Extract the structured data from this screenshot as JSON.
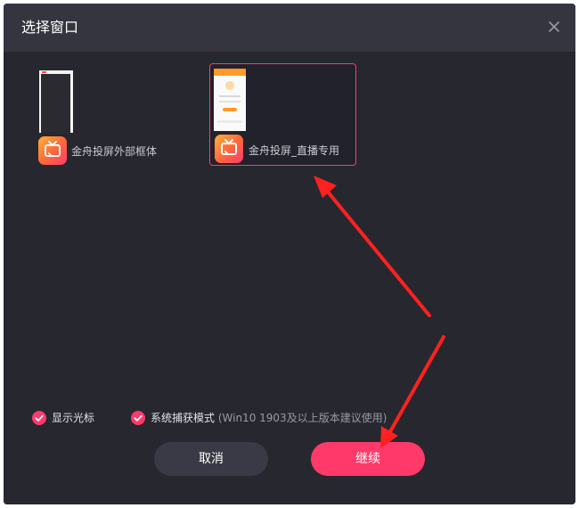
{
  "dialog": {
    "title": "选择窗口",
    "close_icon": "close-icon"
  },
  "windows": [
    {
      "label": "金舟投屏外部框体",
      "selected": false,
      "icon": "app-cast-icon"
    },
    {
      "label": "金舟投屏_直播专用",
      "selected": true,
      "icon": "app-cast-icon"
    }
  ],
  "options": {
    "show_cursor": {
      "label": "显示光标",
      "checked": true
    },
    "system_capture": {
      "label": "系统捕获模式",
      "hint": "(Win10 1903及以上版本建议使用)",
      "checked": true
    }
  },
  "buttons": {
    "cancel_label": "取消",
    "continue_label": "继续"
  },
  "colors": {
    "accent": "#ff3a6a",
    "background": "#27272f",
    "header": "#35353f",
    "annotation_arrow": "#ff2020"
  }
}
